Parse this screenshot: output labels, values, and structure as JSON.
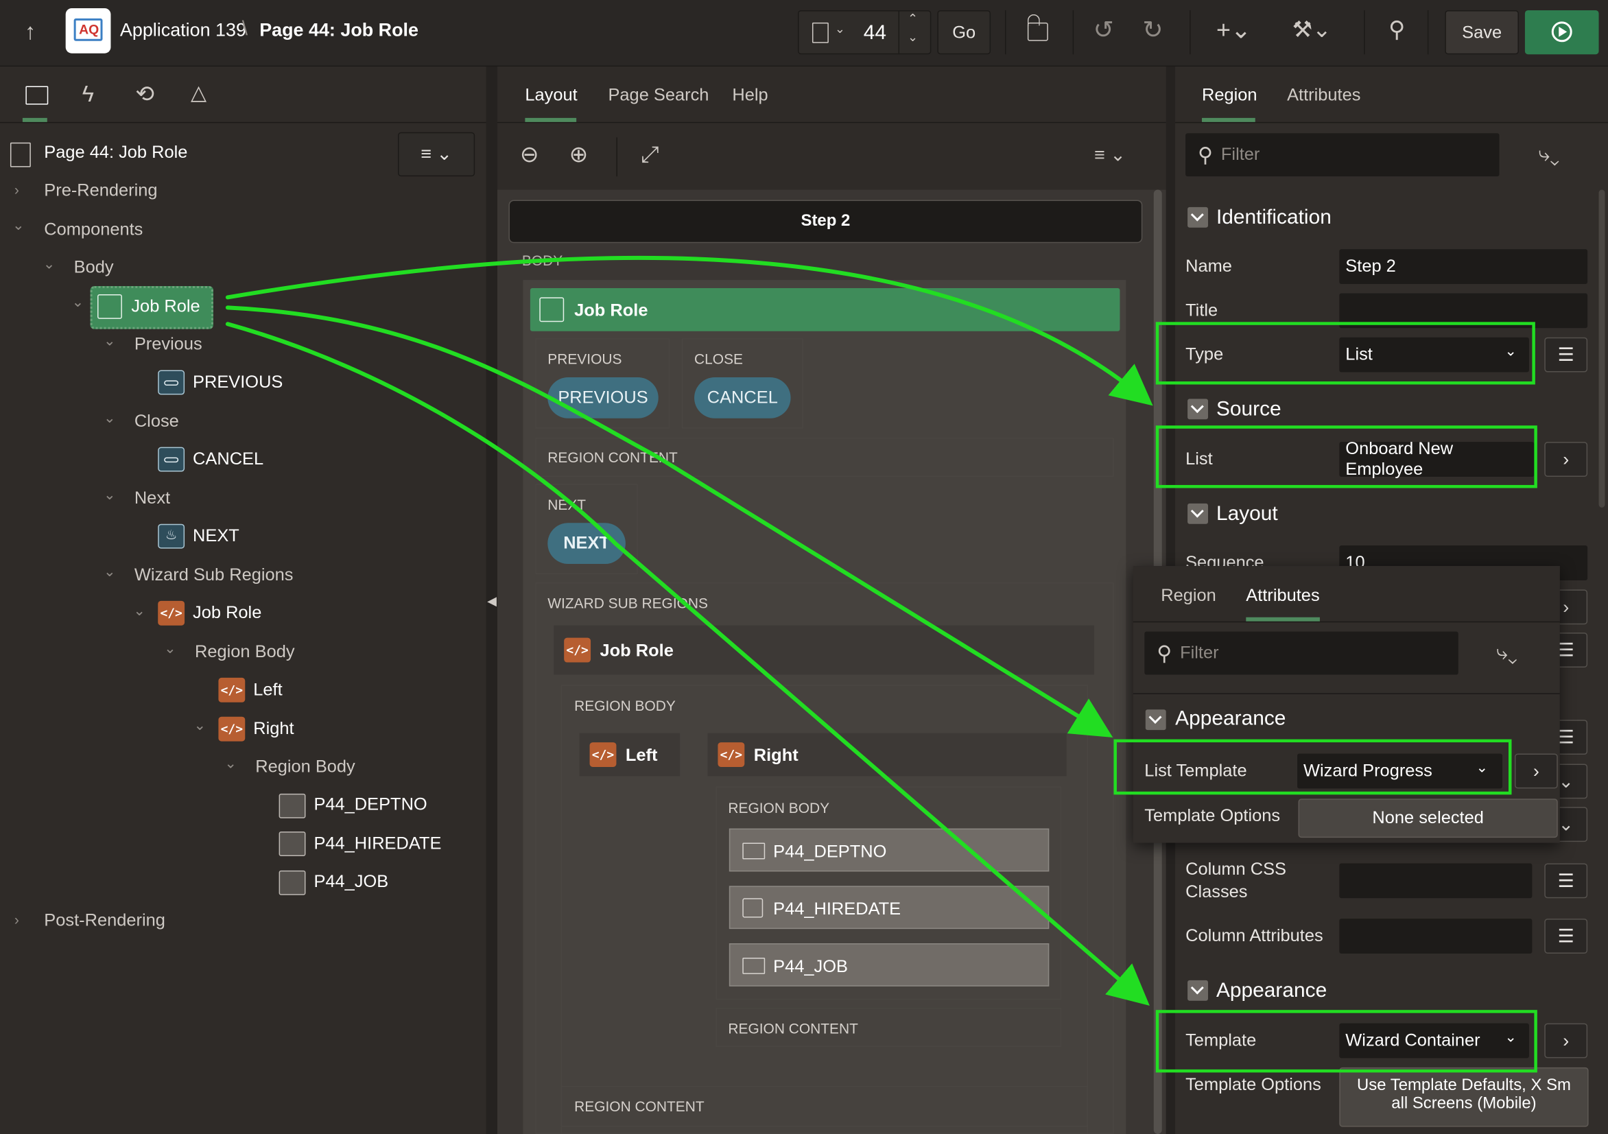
{
  "header": {
    "app_name": "Application 139",
    "separator": "\\",
    "page_title": "Page 44: Job Role",
    "page_number": "44",
    "go_label": "Go",
    "save_label": "Save"
  },
  "left_panel": {
    "page_label": "Page 44: Job Role",
    "tree": {
      "pre_rendering": "Pre-Rendering",
      "components": "Components",
      "body": "Body",
      "job_role_list": "Job Role",
      "previous": "Previous",
      "previous_btn": "PREVIOUS",
      "close": "Close",
      "cancel_btn": "CANCEL",
      "next": "Next",
      "next_btn": "NEXT",
      "wizard_sub_regions": "Wizard Sub Regions",
      "job_role_region": "Job Role",
      "region_body": "Region Body",
      "left": "Left",
      "right": "Right",
      "region_body_2": "Region Body",
      "item_deptno": "P44_DEPTNO",
      "item_hiredate": "P44_HIREDATE",
      "item_job": "P44_JOB",
      "post_rendering": "Post-Rendering"
    }
  },
  "center_panel": {
    "tabs": [
      "Layout",
      "Page Search",
      "Help"
    ],
    "step_title": "Step 2",
    "body_label": "BODY",
    "job_role_list": "Job Role",
    "previous_label": "PREVIOUS",
    "previous_btn": "PREVIOUS",
    "close_label": "CLOSE",
    "cancel_btn": "CANCEL",
    "region_content": "REGION CONTENT",
    "next_label": "NEXT",
    "next_btn": "NEXT",
    "wizard_sub_regions": "WIZARD SUB REGIONS",
    "job_role_region": "Job Role",
    "region_body": "REGION BODY",
    "left": "Left",
    "right": "Right",
    "region_body_2": "REGION BODY",
    "item_deptno": "P44_DEPTNO",
    "item_hiredate": "P44_HIREDATE",
    "item_job": "P44_JOB",
    "region_content_2": "REGION CONTENT",
    "region_content_3": "REGION CONTENT"
  },
  "right_panel": {
    "tabs": [
      "Region",
      "Attributes"
    ],
    "filter_placeholder": "Filter",
    "identification": "Identification",
    "name_label": "Name",
    "name_value": "Step 2",
    "title_label": "Title",
    "title_value": "",
    "type_label": "Type",
    "type_value": "List",
    "source": "Source",
    "list_label": "List",
    "list_value": "Onboard New Employee",
    "layout": "Layout",
    "sequence_label": "Sequence",
    "sequence_value": "10",
    "column_css_label_1": "Column CSS",
    "column_css_label_2": "Classes",
    "column_attributes_label": "Column Attributes",
    "appearance": "Appearance",
    "template_label": "Template",
    "template_value": "Wizard Container",
    "template_options_label": "Template Options",
    "template_options_value_1": "Use Template Defaults, X Sm",
    "template_options_value_2": "all Screens (Mobile)"
  },
  "overlay_panel": {
    "tabs": [
      "Region",
      "Attributes"
    ],
    "filter_placeholder": "Filter",
    "appearance": "Appearance",
    "list_template_label": "List Template",
    "list_template_value": "Wizard Progress",
    "template_options_label": "Template Options",
    "template_options_value": "None selected"
  },
  "colors": {
    "highlight": "#22dd22",
    "run_button": "#2e7d4f",
    "list_region_green": "#3f8c5a",
    "button_teal": "#3f6f80",
    "code_icon_orange": "#b75e31"
  }
}
